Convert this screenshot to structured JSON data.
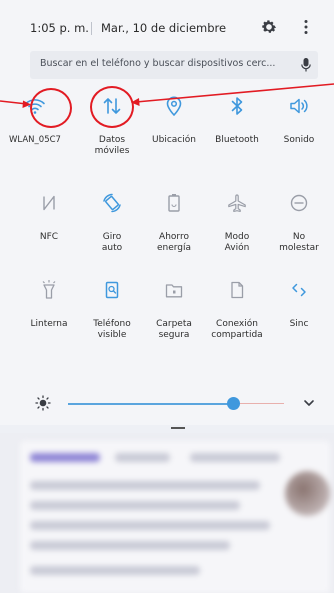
{
  "status": {
    "time": "1:05 p. m.",
    "date": "Mar., 10 de diciembre"
  },
  "search": {
    "placeholder": "Buscar en el teléfono y buscar dispositivos cerc..."
  },
  "tiles": [
    {
      "label": "WLAN_05C7",
      "icon": "wifi-icon"
    },
    {
      "label": "Datos\nmóviles",
      "icon": "mobile-data-icon"
    },
    {
      "label": "Ubicación",
      "icon": "location-icon"
    },
    {
      "label": "Bluetooth",
      "icon": "bluetooth-icon"
    },
    {
      "label": "Sonido",
      "icon": "sound-icon"
    },
    {
      "label": "NFC",
      "icon": "nfc-icon"
    },
    {
      "label": "Giro\nauto",
      "icon": "auto-rotate-icon"
    },
    {
      "label": "Ahorro\nenergía",
      "icon": "battery-saver-icon"
    },
    {
      "label": "Modo\nAvión",
      "icon": "airplane-icon"
    },
    {
      "label": "No\nmolestar",
      "icon": "do-not-disturb-icon"
    },
    {
      "label": "Linterna",
      "icon": "flashlight-icon"
    },
    {
      "label": "Teléfono\nvisible",
      "icon": "phone-visible-icon"
    },
    {
      "label": "Carpeta\nsegura",
      "icon": "secure-folder-icon"
    },
    {
      "label": "Conexión\ncompartida",
      "icon": "hotspot-icon"
    },
    {
      "label": "Sinc",
      "icon": "sync-icon"
    }
  ],
  "brightness": {
    "level": 0.8
  },
  "colors": {
    "active": "#3f98dd",
    "inactive": "#9a9ea8",
    "annotation": "#e21b23"
  }
}
